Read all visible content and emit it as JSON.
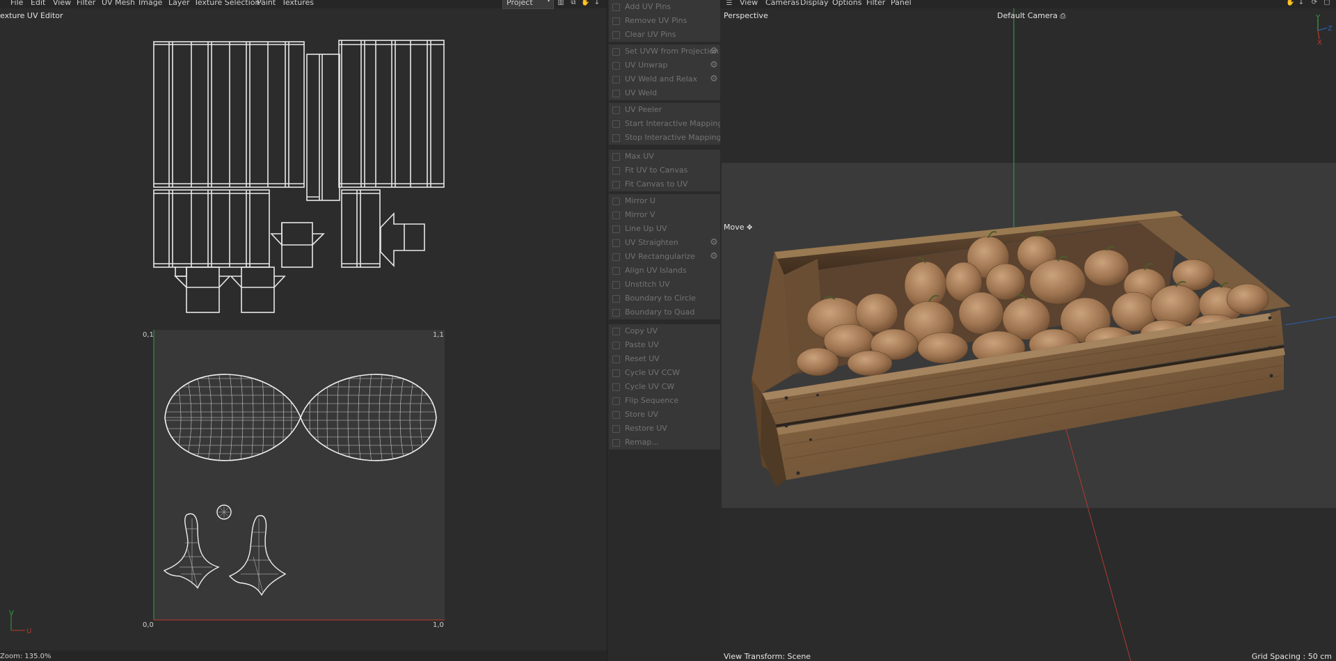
{
  "uv_editor": {
    "menu": [
      "File",
      "Edit",
      "View",
      "Filter",
      "UV Mesh",
      "Image",
      "Layer",
      "Texture Selection",
      "Paint",
      "Textures"
    ],
    "project_select": "Project",
    "title": "exture UV Editor",
    "coords": {
      "top_left": "0,1",
      "top_right": "1,1",
      "bottom_left": "0,0",
      "bottom_right": "1,0"
    },
    "axis_v": "V",
    "axis_u": "U",
    "zoom": "Zoom: 135.0%"
  },
  "tools": {
    "groups": [
      [
        {
          "label": "Add UV Pins",
          "icon": "pin-icon",
          "gear": false
        },
        {
          "label": "Remove UV Pins",
          "icon": "pin-remove-icon",
          "gear": false
        },
        {
          "label": "Clear UV Pins",
          "icon": "close-icon",
          "gear": false
        }
      ],
      [
        {
          "label": "Set UVW from Projection",
          "icon": "projection-icon",
          "gear": true
        },
        {
          "label": "UV Unwrap",
          "icon": "unwrap-icon",
          "gear": true
        },
        {
          "label": "UV Weld and Relax",
          "icon": "weld-relax-icon",
          "gear": true
        },
        {
          "label": "UV Weld",
          "icon": "weld-icon",
          "gear": false
        }
      ],
      [
        {
          "label": "UV Peeler",
          "icon": "peeler-icon",
          "gear": false
        },
        {
          "label": "Start Interactive Mapping",
          "icon": "play-icon",
          "gear": false
        },
        {
          "label": "Stop Interactive Mapping",
          "icon": "stop-icon",
          "gear": false
        }
      ],
      [
        {
          "label": "Max UV",
          "icon": "max-uv-icon",
          "gear": false
        },
        {
          "label": "Fit UV to Canvas",
          "icon": "fit-uv-icon",
          "gear": false
        },
        {
          "label": "Fit Canvas to UV",
          "icon": "fit-canvas-icon",
          "gear": false
        }
      ],
      [
        {
          "label": "Mirror U",
          "icon": "mirror-u-icon",
          "gear": false
        },
        {
          "label": "Mirror V",
          "icon": "mirror-v-icon",
          "gear": false
        },
        {
          "label": "Line Up UV",
          "icon": "line-up-icon",
          "gear": false
        },
        {
          "label": "UV Straighten",
          "icon": "straighten-icon",
          "gear": true
        },
        {
          "label": "UV Rectangularize",
          "icon": "rectangularize-icon",
          "gear": true
        },
        {
          "label": "Align UV Islands",
          "icon": "align-icon",
          "gear": false
        },
        {
          "label": "Unstitch UV",
          "icon": "unstitch-icon",
          "gear": false
        },
        {
          "label": "Boundary to Circle",
          "icon": "circle-icon",
          "gear": false
        },
        {
          "label": "Boundary to Quad",
          "icon": "quad-icon",
          "gear": false
        }
      ],
      [
        {
          "label": "Copy UV",
          "icon": "copy-icon",
          "gear": false
        },
        {
          "label": "Paste UV",
          "icon": "paste-icon",
          "gear": false
        },
        {
          "label": "Reset UV",
          "icon": "reset-icon",
          "gear": false
        },
        {
          "label": "Cycle UV CCW",
          "icon": "cycle-ccw-icon",
          "gear": false
        },
        {
          "label": "Cycle UV CW",
          "icon": "cycle-cw-icon",
          "gear": false
        },
        {
          "label": "Flip Sequence",
          "icon": "flip-icon",
          "gear": false
        },
        {
          "label": "Store UV",
          "icon": "store-icon",
          "gear": false
        },
        {
          "label": "Restore UV",
          "icon": "restore-icon",
          "gear": false
        },
        {
          "label": "Remap...",
          "icon": "remap-icon",
          "gear": false
        }
      ]
    ]
  },
  "viewport": {
    "menu": [
      "View",
      "Cameras",
      "Display",
      "Options",
      "Filter",
      "Panel"
    ],
    "projection": "Perspective",
    "camera": "Default Camera",
    "tool_label": "Move",
    "view_transform": "View Transform: Scene",
    "grid_spacing": "Grid Spacing : 50 cm",
    "gizmo": {
      "y": "Y",
      "z": "Z",
      "x": "X"
    }
  },
  "colors": {
    "panel_bg": "#2c2c2c",
    "uv_canvas": "#383838",
    "wire": "#e8e8e8",
    "axis_u": "#c0392b",
    "axis_v": "#2ea043",
    "wood_light": "#8a6a44",
    "wood_dark": "#4a3523",
    "kiwi": "#a67e58"
  }
}
